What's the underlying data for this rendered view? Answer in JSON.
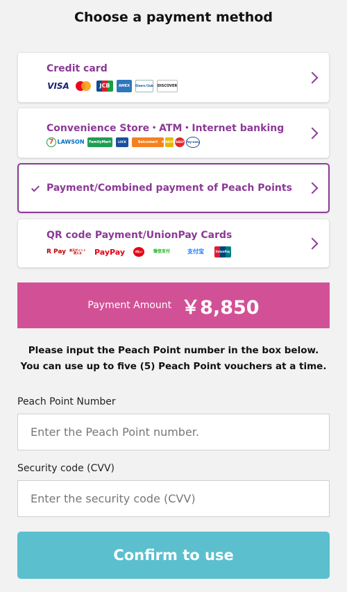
{
  "header": {
    "title": "Choose a payment method"
  },
  "methods": [
    {
      "label": "Credit card",
      "logos": [
        "VISA",
        "Mastercard",
        "JCB",
        "AMEX",
        "Diners Club",
        "DISCOVER"
      ]
    },
    {
      "label": "Convenience Store・ATM・Internet banking",
      "logos": [
        "7",
        "LAWSON",
        "FamilyMart",
        "LOCK",
        "Seicomart",
        "MINISTOP",
        "DAILY",
        "Pay-easy"
      ]
    },
    {
      "label": "Payment/Combined payment of Peach Points",
      "selected": true
    },
    {
      "label": "QR code Payment/UnionPay Cards",
      "logos": [
        "R Pay",
        "楽天ポイント使える",
        "PayPay",
        "d払い",
        "微信支付",
        "支付宝",
        "UnionPay"
      ]
    }
  ],
  "payment": {
    "label": "Payment Amount",
    "amount": "￥8,850"
  },
  "notice": "Please input the Peach Point number in the box below. You can use up to five (5) Peach Point vouchers at a time.",
  "form": {
    "point_label": "Peach Point Number",
    "point_placeholder": "Enter the Peach Point number.",
    "cvv_label": "Security code (CVV)",
    "cvv_placeholder": "Enter the security code (CVV)"
  },
  "confirm_label": "Confirm to use",
  "colors": {
    "accent": "#8b3a96",
    "amount_bar": "#d25196",
    "confirm": "#5bbfce",
    "background": "#f2f2f2"
  },
  "icons": {
    "chevron": "chevron-right-icon",
    "check": "check-icon"
  }
}
